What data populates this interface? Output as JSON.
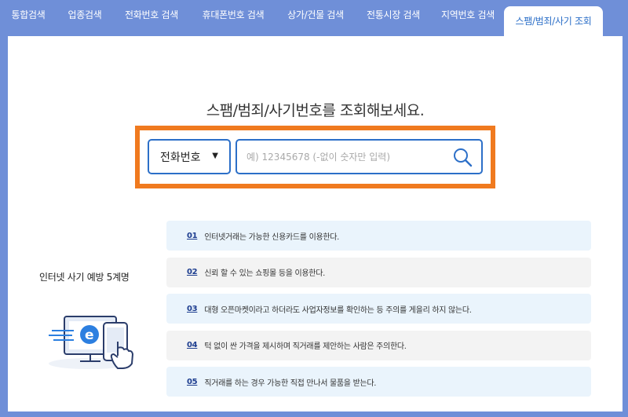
{
  "tabs": [
    {
      "label": "통합검색",
      "active": false
    },
    {
      "label": "업종검색",
      "active": false
    },
    {
      "label": "전화번호 검색",
      "active": false
    },
    {
      "label": "휴대폰번호 검색",
      "active": false
    },
    {
      "label": "상가/건물 검색",
      "active": false
    },
    {
      "label": "전통시장 검색",
      "active": false
    },
    {
      "label": "지역번호 검색",
      "active": false
    },
    {
      "label": "스팸/범죄/사기 조회",
      "active": true
    }
  ],
  "main": {
    "title": "스팸/범죄/사기번호를 조회해보세요.",
    "select_value": "전화번호",
    "select_arrow": "▼",
    "search_placeholder": "예) 12345678 (-없이 숫자만 입력)",
    "search_value": ""
  },
  "side": {
    "title_main": "인터넷 사기 예방 ",
    "title_count": "5계명"
  },
  "tips": [
    {
      "num": "01",
      "text": "인터넷거래는 가능한 신용카드를 이용한다."
    },
    {
      "num": "02",
      "text": "신뢰 할 수 있는 쇼핑몰 등을 이용한다."
    },
    {
      "num": "03",
      "text": "대형 오픈마켓이라고 하더라도 사업자정보를 확인하는 등 주의를 게을리 하지 않는다."
    },
    {
      "num": "04",
      "text": "턱 없이 싼 가격을 제시하며 직거래를 제안하는 사람은 주의한다."
    },
    {
      "num": "05",
      "text": "직거래를 하는 경우 가능한 직접 만나서 물품을 받는다."
    }
  ],
  "colors": {
    "tab_bar": "#6f8fd8",
    "accent_blue": "#2c6fc8",
    "highlight_orange": "#f07a1f",
    "tip_blue_bg": "#eaf4fc",
    "tip_gray_bg": "#f3f3f3"
  },
  "icons": {
    "search": "search-icon",
    "illustration": "e-commerce-device-icon"
  }
}
